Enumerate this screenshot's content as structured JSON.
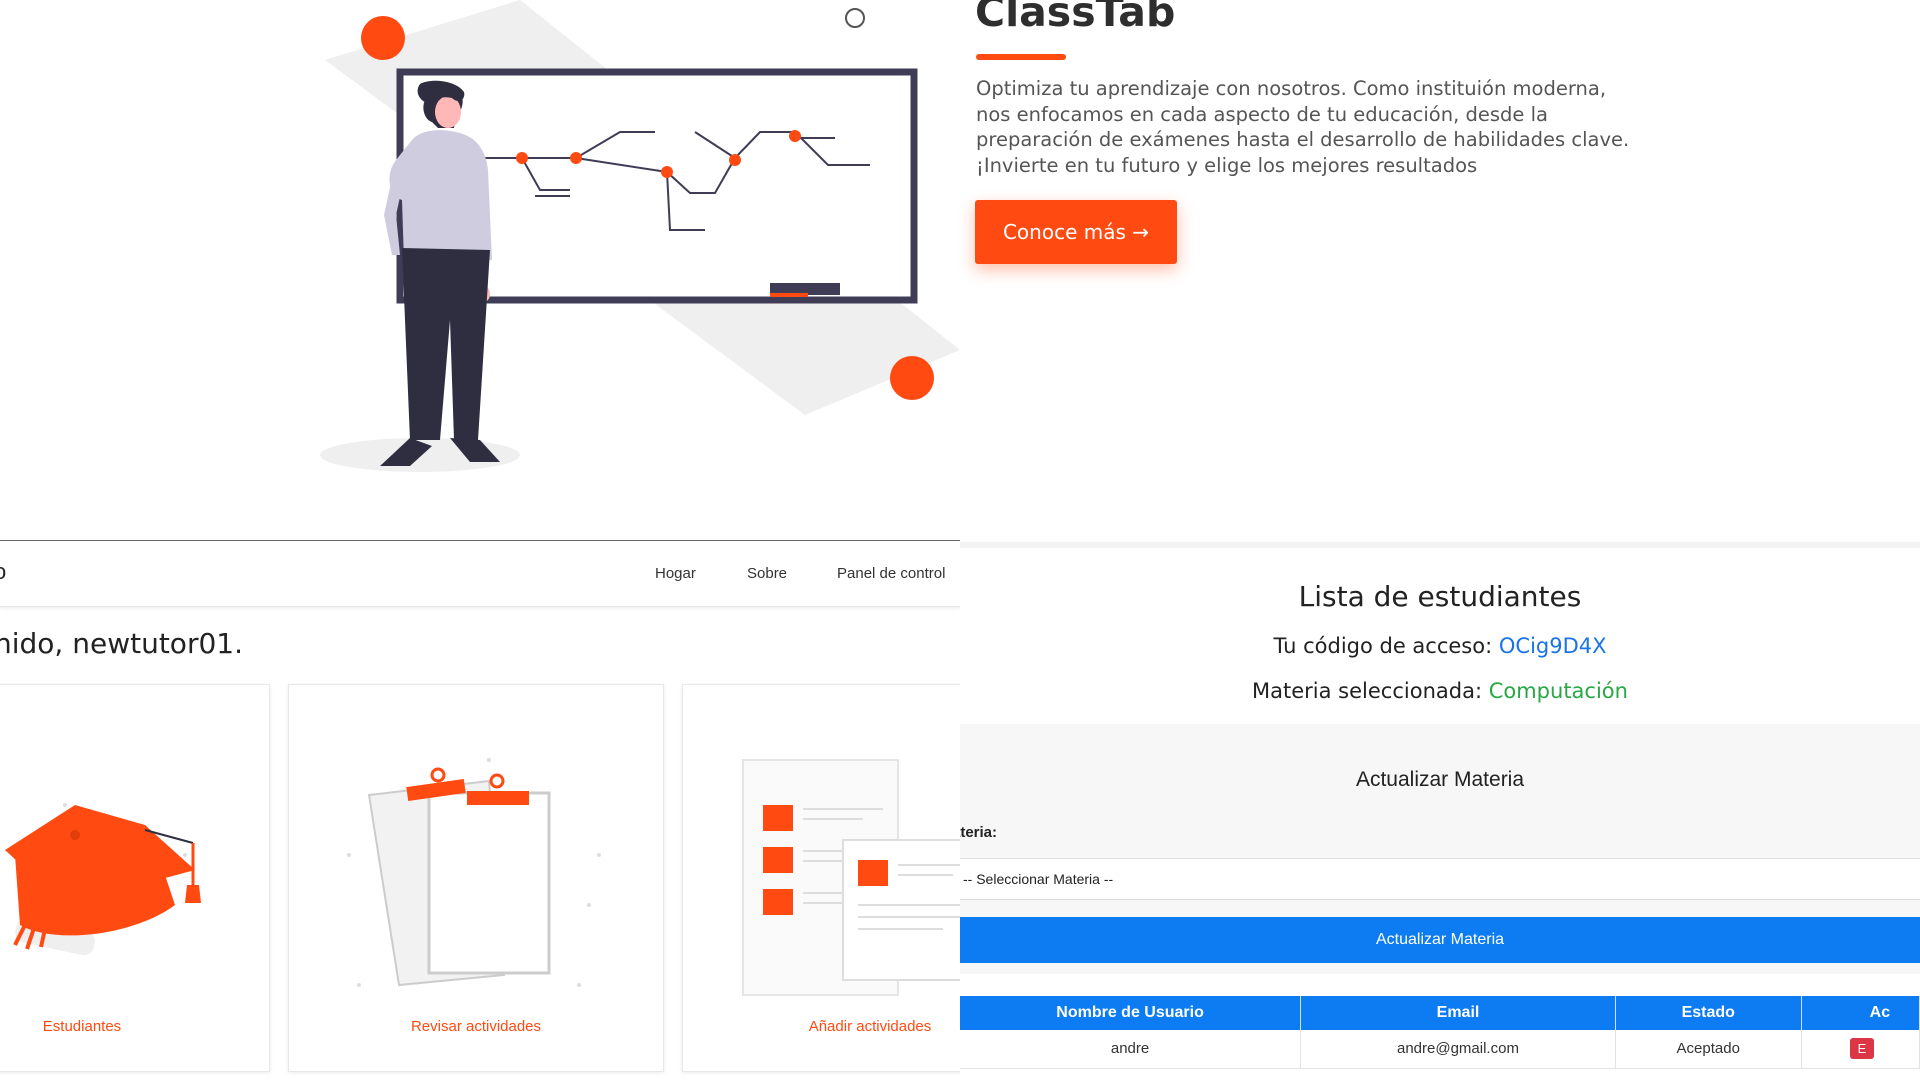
{
  "hero": {
    "title": "ClassTab",
    "description_lines": [
      "Optimiza tu aprendizaje con nosotros. Como instituión moderna,",
      "nos enfocamos en cada aspecto de tu educación, desde la",
      "preparación de exámenes hasta el desarrollo de habilidades clave.",
      "¡Invierte en tu futuro y elige los mejores resultados"
    ],
    "cta_label": "Conoce más →",
    "accent_color": "#ff4b12"
  },
  "dashboard": {
    "brand_fragment": "o",
    "nav": {
      "home": "Hogar",
      "about": "Sobre",
      "panel": "Panel de control"
    },
    "welcome": "nido, newtutor01.",
    "cards": {
      "students": "Estudiantes",
      "review": "Revisar actividades",
      "add": "Añadir actividades"
    }
  },
  "students_view": {
    "title": "Lista de estudiantes",
    "access_label": "Tu código de acceso:",
    "access_code": "OCig9D4X",
    "subject_label": "Materia seleccionada:",
    "subject_value": "Computación",
    "update": {
      "title": "Actualizar Materia",
      "field_label": "ateria:",
      "select_value": "-- Seleccionar Materia --",
      "button_label": "Actualizar Materia"
    },
    "table": {
      "headers": {
        "username": "Nombre de Usuario",
        "email": "Email",
        "status": "Estado",
        "actions": "Ac"
      },
      "rows": [
        {
          "username": "andre",
          "email": "andre@gmail.com",
          "status": "Aceptado",
          "action_label": "E"
        }
      ]
    },
    "colors": {
      "primary": "#0d7cf2",
      "success": "#27a844",
      "danger": "#dc3545",
      "link": "#1a73e8"
    }
  }
}
